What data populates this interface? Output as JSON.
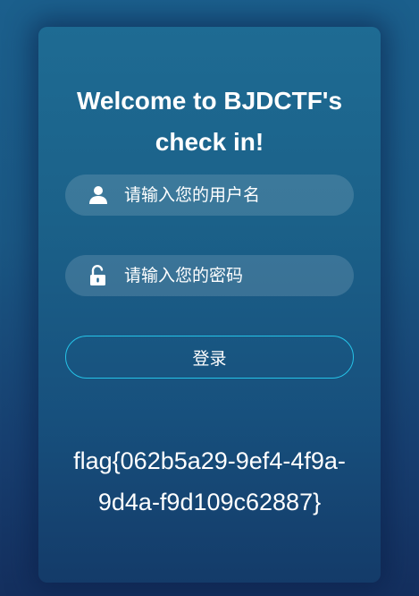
{
  "login": {
    "title_line1": "Welcome to BJDCTF's",
    "title_line2": "check in!",
    "username_placeholder": "请输入您的用户名",
    "password_placeholder": "请输入您的密码",
    "login_label": "登录",
    "flag_line1": "flag{062b5a29-9ef4-4f9a-",
    "flag_line2": "9d4a-f9d109c62887}",
    "icons": [
      "user-icon",
      "unlock-icon"
    ],
    "colors": {
      "button_border": "#25c3e8",
      "text": "#ffffff",
      "background_top": "#1b5f8c",
      "background_bottom": "#142f5e"
    }
  }
}
